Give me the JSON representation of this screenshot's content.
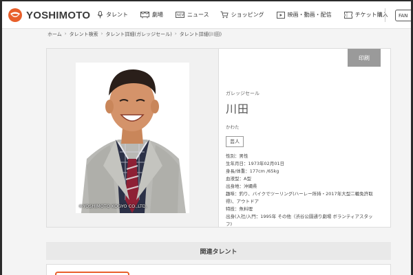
{
  "header": {
    "brand": "YOSHIMOTO",
    "nav": [
      {
        "label": "タレント",
        "icon": "microphone-icon"
      },
      {
        "label": "劇場",
        "icon": "theater-icon"
      },
      {
        "label": "ニュース",
        "icon": "news-icon"
      },
      {
        "label": "ショッピング",
        "icon": "cart-icon"
      },
      {
        "label": "映画・動画・配信",
        "icon": "video-icon"
      },
      {
        "label": "チケット購入",
        "icon": "ticket-icon"
      }
    ],
    "fan_button": "FAN"
  },
  "breadcrumb": [
    "ホーム",
    "タレント検索",
    "タレント詳細(ガレッジセール)",
    "タレント詳細(川田)"
  ],
  "talent": {
    "photo_copyright": "©YOSHIMOTO KOGYO CO.,LTD.",
    "print_label": "印刷",
    "unit": "ガレッジセール",
    "name": "川田",
    "reading": "かわた",
    "badge": "芸人",
    "profile": [
      "性別：男性",
      "生年月日：1973年02月01日",
      "身長/体重：177cm /65kg",
      "血液型：A型",
      "出身地：沖縄県",
      "趣味：釣り、バイクでツーリング(ハーレー所持・2017年大型二輪免許取",
      "得)、アウトドア",
      "特技：魚料理",
      "出身(入社/入門：1995年 その他（渋谷公園通り劇場 ボランティアスタッ",
      "フ)"
    ]
  },
  "related": {
    "heading": "関連タレント"
  },
  "colors": {
    "brand": "#e85f2a",
    "print_button": "#9a9a9a"
  }
}
